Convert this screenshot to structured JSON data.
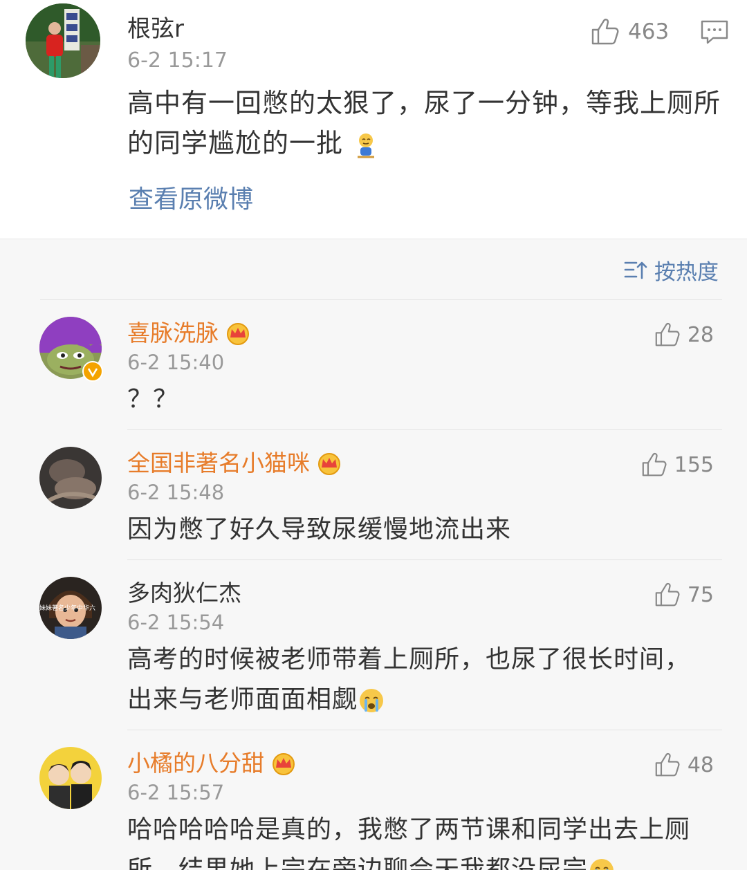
{
  "main_comment": {
    "author": "根弦r",
    "time": "6-2 15:17",
    "likes": "463",
    "text": "高中有一回憋的太狠了，尿了一分钟，等我上厕所的同学尴尬的一批",
    "view_original": "查看原微博"
  },
  "sort": {
    "label": "按热度"
  },
  "replies": [
    {
      "author": "喜脉洗脉",
      "time": "6-2 15:40",
      "likes": "28",
      "text": "？？",
      "vip": true
    },
    {
      "author": "全国非著名小猫咪",
      "time": "6-2 15:48",
      "likes": "155",
      "text": "因为憋了好久导致尿缓慢地流出来",
      "vip": true
    },
    {
      "author": "多肉狄仁杰",
      "time": "6-2 15:54",
      "likes": "75",
      "text": "高考的时候被老师带着上厕所，也尿了很长时间，出来与老师面面相觑",
      "vip": false,
      "avatar_caption": "妹妹著名少年中华六"
    },
    {
      "author": "小橘的八分甜",
      "time": "6-2 15:57",
      "likes": "48",
      "text": "哈哈哈哈哈是真的，我憋了两节课和同学出去上厕所，结果她上完在旁边聊会天我都没尿完",
      "vip": true
    }
  ],
  "colors": {
    "vip_name": "#e77c2a",
    "link": "#5a7fb0",
    "muted": "#999999"
  },
  "icons": [
    "like-icon",
    "comment-icon",
    "sort-icon",
    "crown-icon",
    "verified-badge-icon",
    "emoji-icon"
  ]
}
